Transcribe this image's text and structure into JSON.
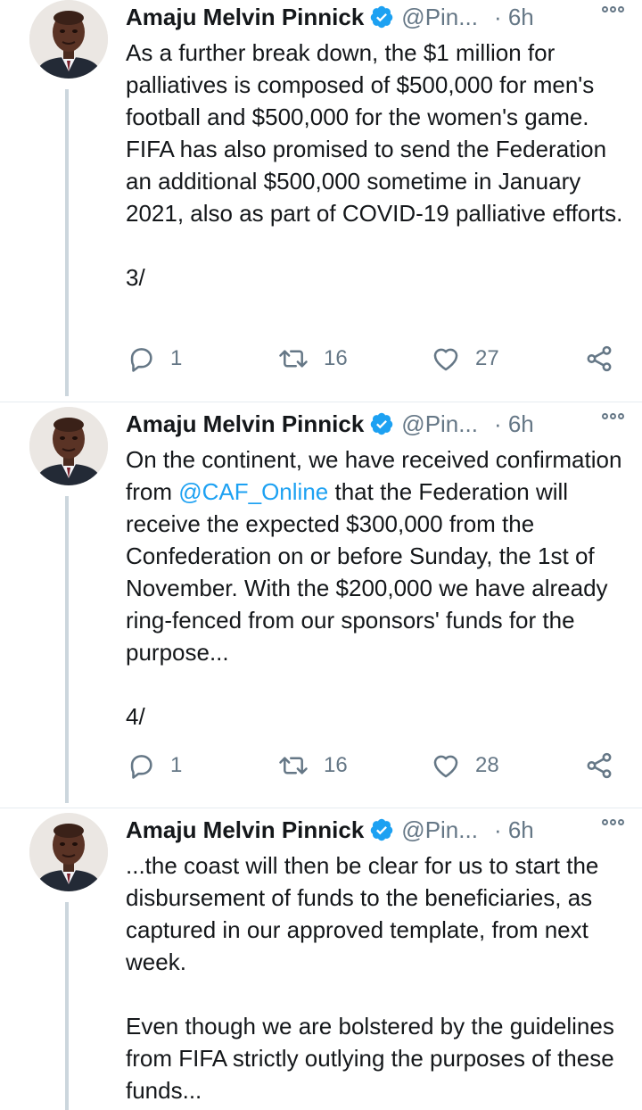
{
  "tweets": [
    {
      "name": "Amaju Melvin Pinnick",
      "handle": "@Pin...",
      "time": "· 6h",
      "text": "As a further break down, the $1 million for palliatives is composed of $500,000 for men's football and $500,000 for the women's game. FIFA has also promised to send the Federation an additional $500,000 sometime in January 2021, also as part of COVID-19 palliative efforts.",
      "footer": "3/",
      "replies": "1",
      "retweets": "16",
      "likes": "27"
    },
    {
      "name": "Amaju Melvin Pinnick",
      "handle": "@Pin...",
      "time": "· 6h",
      "text_before": "On the continent, we have received confirmation from ",
      "mention": "@CAF_Online",
      "text_after": " that the Federation will receive the expected $300,000 from the Confederation on or before Sunday, the 1st of November. With the $200,000 we have already ring-fenced from our sponsors' funds for the purpose...",
      "footer": "4/",
      "replies": "1",
      "retweets": "16",
      "likes": "28"
    },
    {
      "name": "Amaju Melvin Pinnick",
      "handle": "@Pin...",
      "time": "· 6h",
      "text": "...the coast will then be clear for us to start the disbursement of funds to the beneficiaries, as captured in our approved template, from next week.",
      "text2": "Even though we are bolstered by the guidelines from FIFA strictly outlying the purposes of these funds..."
    }
  ],
  "icons": {
    "verified": "verified-badge-icon",
    "more": "more-options-icon",
    "reply": "reply-icon",
    "retweet": "retweet-icon",
    "like": "heart-icon",
    "share": "share-icon"
  },
  "colors": {
    "accent": "#1da1f2",
    "secondary_text": "#657786",
    "thread_line": "#ccd6dd"
  }
}
